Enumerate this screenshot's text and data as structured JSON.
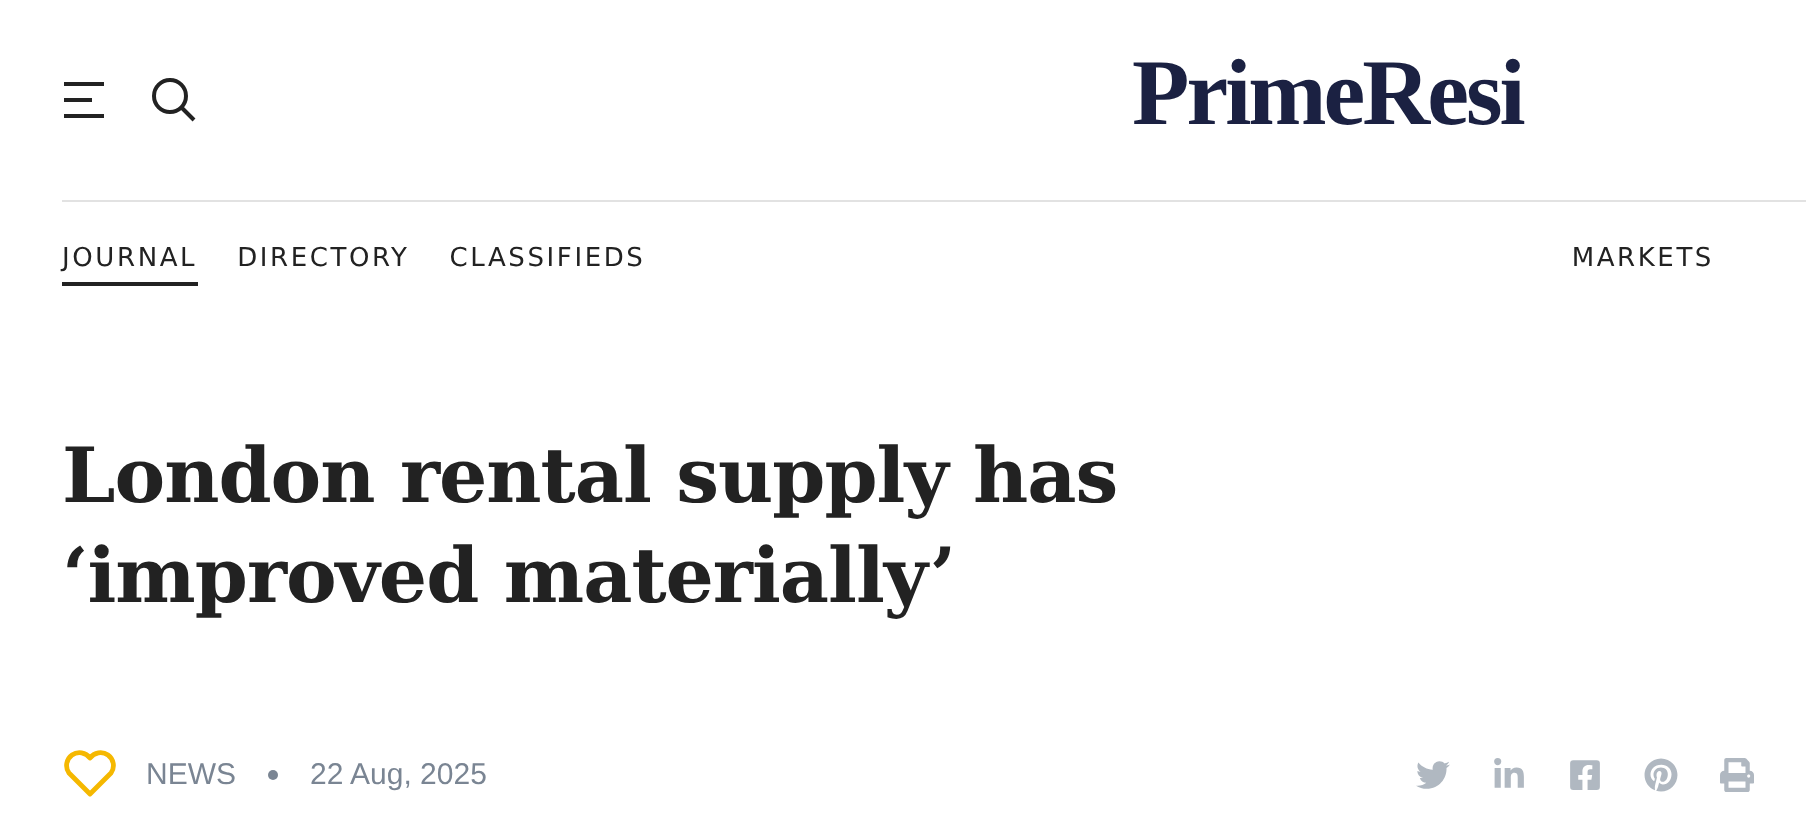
{
  "logo": "PrimeResi",
  "nav": [
    {
      "label": "JOURNAL",
      "selected": true
    },
    {
      "label": "DIRECTORY",
      "selected": false
    },
    {
      "label": "CLASSIFIEDS",
      "selected": false
    }
  ],
  "nav_right": {
    "label": "MARKETS",
    "selected": false
  },
  "headline": "London rental supply has ‘improved materially’",
  "meta": {
    "category": "NEWS",
    "date": "22 Aug, 2025"
  }
}
